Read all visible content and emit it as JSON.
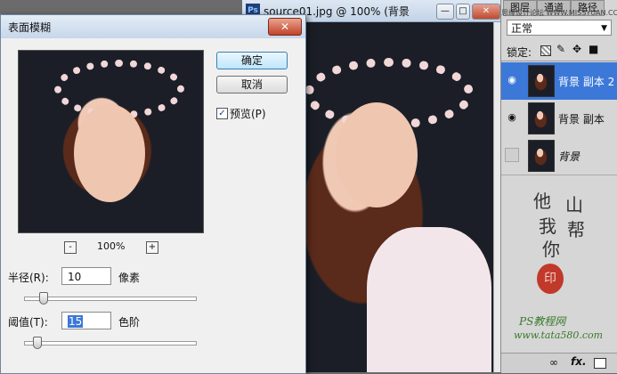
{
  "document": {
    "ps_icon": "Ps",
    "title": "source01.jpg @ 100% (背景",
    "buttons": {
      "minimize": "—",
      "maximize": "□",
      "close": "✕"
    }
  },
  "dialog": {
    "title": "表面模糊",
    "close": "✕",
    "ok_label": "确定",
    "cancel_label": "取消",
    "preview_checked": true,
    "preview_label": "预览(P)",
    "zoom_out": "-",
    "zoom_in": "+",
    "zoom": "100%",
    "radius_label": "半径(R):",
    "radius_value": "10",
    "radius_unit": "像素",
    "radius_level": 0.09,
    "threshold_label": "阈值(T):",
    "threshold_value": "15",
    "threshold_unit": "色阶",
    "threshold_level": 0.05
  },
  "panels": {
    "tabs": [
      "图层",
      "通道",
      "路径"
    ],
    "watermark_site": "思缘设计论坛 WWW.MISSYUAN.COM",
    "blend_mode": "正常",
    "lock_label": "锁定:",
    "layers": [
      {
        "name": "背景 副本 2",
        "visible": true,
        "selected": true
      },
      {
        "name": "背景 副本",
        "visible": true,
        "selected": false
      },
      {
        "name": "背景",
        "visible": false,
        "selected": false
      }
    ],
    "calligraphy": [
      "他",
      "山",
      "我",
      "帮",
      "你"
    ],
    "seal": "印",
    "site_name": "PS教程网",
    "site_url": "www.tata580.com",
    "footer_icons": [
      "link-icon",
      "fx-icon",
      "mask-icon"
    ]
  },
  "colors": {
    "selection": "#3c78d8",
    "ok_button": "#bee6fd",
    "seal": "#c0392b"
  }
}
